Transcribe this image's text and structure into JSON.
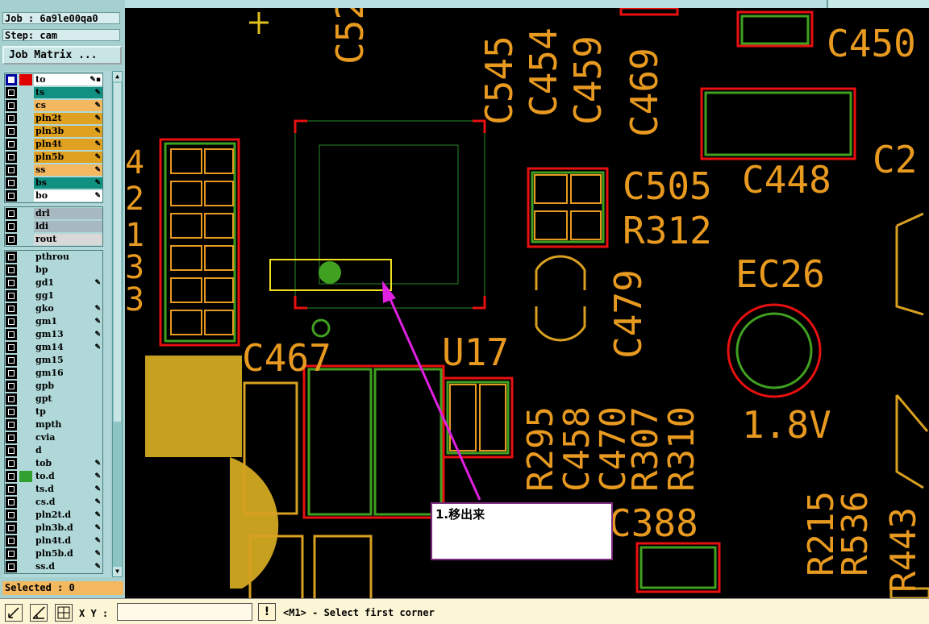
{
  "job": {
    "label": "Job : 6a9le00qa0",
    "step": "Step: cam",
    "matrix_button": "Job Matrix ..."
  },
  "layers": [
    {
      "name": "to",
      "color": "#ffffff",
      "checked": true,
      "swatch": "#e00000",
      "mark": "✎▪"
    },
    {
      "name": "ts",
      "color": "#109080",
      "checked": false,
      "mark": "✎"
    },
    {
      "name": "cs",
      "color": "#f3b860",
      "checked": false,
      "mark": "✎"
    },
    {
      "name": "pln2t",
      "color": "#e0a020",
      "checked": false,
      "mark": "✎"
    },
    {
      "name": "pln3b",
      "color": "#e0a020",
      "checked": false,
      "mark": "✎"
    },
    {
      "name": "pln4t",
      "color": "#e0a020",
      "checked": false,
      "mark": "✎"
    },
    {
      "name": "pln5b",
      "color": "#e0a020",
      "checked": false,
      "mark": "✎"
    },
    {
      "name": "ss",
      "color": "#f3b860",
      "checked": false,
      "mark": "✎"
    },
    {
      "name": "bs",
      "color": "#109080",
      "checked": false,
      "mark": "✎"
    },
    {
      "name": "bo",
      "color": "#ffffff",
      "checked": false,
      "mark": "✎"
    },
    {
      "name": "drl",
      "color": "#a8b8c0",
      "checked": false,
      "mark": ""
    },
    {
      "name": "ldi",
      "color": "#a8b8c0",
      "checked": false,
      "mark": ""
    },
    {
      "name": "rout",
      "color": "#d8d8d8",
      "checked": false,
      "mark": ""
    },
    {
      "name": "pthrou",
      "color": "#b0d8d8",
      "checked": false,
      "mark": ""
    },
    {
      "name": "bp",
      "color": "#b0d8d8",
      "checked": false,
      "mark": ""
    },
    {
      "name": "gd1",
      "color": "#b0d8d8",
      "checked": false,
      "mark": "✎"
    },
    {
      "name": "gg1",
      "color": "#b0d8d8",
      "checked": false,
      "mark": ""
    },
    {
      "name": "gko",
      "color": "#b0d8d8",
      "checked": false,
      "mark": "✎"
    },
    {
      "name": "gm1",
      "color": "#b0d8d8",
      "checked": false,
      "mark": "✎"
    },
    {
      "name": "gm13",
      "color": "#b0d8d8",
      "checked": false,
      "mark": "✎"
    },
    {
      "name": "gm14",
      "color": "#b0d8d8",
      "checked": false,
      "mark": "✎"
    },
    {
      "name": "gm15",
      "color": "#b0d8d8",
      "checked": false,
      "mark": ""
    },
    {
      "name": "gm16",
      "color": "#b0d8d8",
      "checked": false,
      "mark": ""
    },
    {
      "name": "gpb",
      "color": "#b0d8d8",
      "checked": false,
      "mark": ""
    },
    {
      "name": "gpt",
      "color": "#b0d8d8",
      "checked": false,
      "mark": ""
    },
    {
      "name": "tp",
      "color": "#b0d8d8",
      "checked": false,
      "mark": ""
    },
    {
      "name": "mpth",
      "color": "#b0d8d8",
      "checked": false,
      "mark": ""
    },
    {
      "name": "cvia",
      "color": "#b0d8d8",
      "checked": false,
      "mark": ""
    },
    {
      "name": "d",
      "color": "#b0d8d8",
      "checked": false,
      "mark": ""
    },
    {
      "name": "tob",
      "color": "#b0d8d8",
      "checked": false,
      "mark": "✎"
    },
    {
      "name": "to.d",
      "color": "#b0d8d8",
      "checked": false,
      "swatch": "#30a030",
      "mark": "✎"
    },
    {
      "name": "ts.d",
      "color": "#b0d8d8",
      "checked": false,
      "mark": "✎"
    },
    {
      "name": "cs.d",
      "color": "#b0d8d8",
      "checked": false,
      "mark": "✎"
    },
    {
      "name": "pln2t.d",
      "color": "#b0d8d8",
      "checked": false,
      "mark": "✎"
    },
    {
      "name": "pln3b.d",
      "color": "#b0d8d8",
      "checked": false,
      "mark": "✎"
    },
    {
      "name": "pln4t.d",
      "color": "#b0d8d8",
      "checked": false,
      "mark": "✎"
    },
    {
      "name": "pln5b.d",
      "color": "#b0d8d8",
      "checked": false,
      "mark": "✎"
    },
    {
      "name": "ss.d",
      "color": "#b0d8d8",
      "checked": false,
      "mark": "✎"
    }
  ],
  "selected": "Selected : 0",
  "status": {
    "xy_label": "X Y :",
    "xy_value": "",
    "message": "<M1> - Select first corner",
    "warn": "!"
  },
  "annotation": {
    "text": "1.移出来"
  },
  "board_labels": [
    "C52",
    "C545",
    "C454",
    "C459",
    "C469",
    "C450",
    "C505",
    "C448",
    "R312",
    "C2",
    "EC26",
    "C479",
    "C467",
    "U17",
    "R295",
    "C458",
    "C470",
    "R307",
    "R310",
    "1.8V",
    "C388",
    "R215",
    "R536",
    "R443",
    "4",
    "2",
    "1",
    "3",
    "3",
    "3"
  ]
}
